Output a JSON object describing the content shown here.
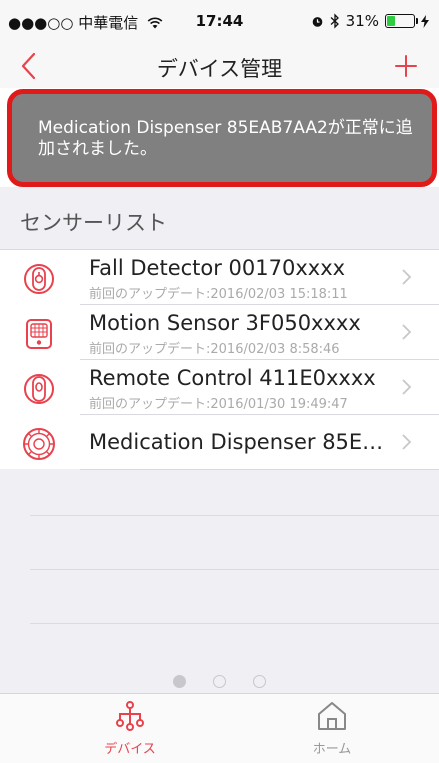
{
  "status_bar": {
    "carrier": "●●●○○ 中華電信",
    "time": "17:44",
    "battery": "31%",
    "battery_level": 0.31
  },
  "nav": {
    "title": "デバイス管理",
    "back_icon": "chevron-left-icon",
    "add_icon": "plus-icon"
  },
  "toast": {
    "message": "Medication Dispenser 85EAB7AA2が正常に追加されました。"
  },
  "section": {
    "title": "センサーリスト"
  },
  "sensors": [
    {
      "name": "Fall Detector 00170xxxx",
      "last_update": "前回のアップデート:2016/02/03 15:18:11",
      "icon": "fall-detector-icon"
    },
    {
      "name": "Motion Sensor 3F050xxxx",
      "last_update": "前回のアップデート:2016/02/03 8:58:46",
      "icon": "motion-sensor-icon"
    },
    {
      "name": "Remote Control 411E0xxxx",
      "last_update": "前回のアップデート:2016/01/30 19:49:47",
      "icon": "remote-control-icon"
    },
    {
      "name": "Medication Dispenser 85E…",
      "last_update": "",
      "icon": "medication-dispenser-icon"
    }
  ],
  "pagination": {
    "pages": 3,
    "current": 1
  },
  "tabs": [
    {
      "label": "デバイス",
      "icon": "devices-icon",
      "active": true
    },
    {
      "label": "ホーム",
      "icon": "home-icon",
      "active": false
    }
  ],
  "colors": {
    "accent": "#e8424d",
    "toast_bg": "#808080",
    "toast_border": "#e01919",
    "list_bg": "#efeff4",
    "inactive": "#999999"
  }
}
